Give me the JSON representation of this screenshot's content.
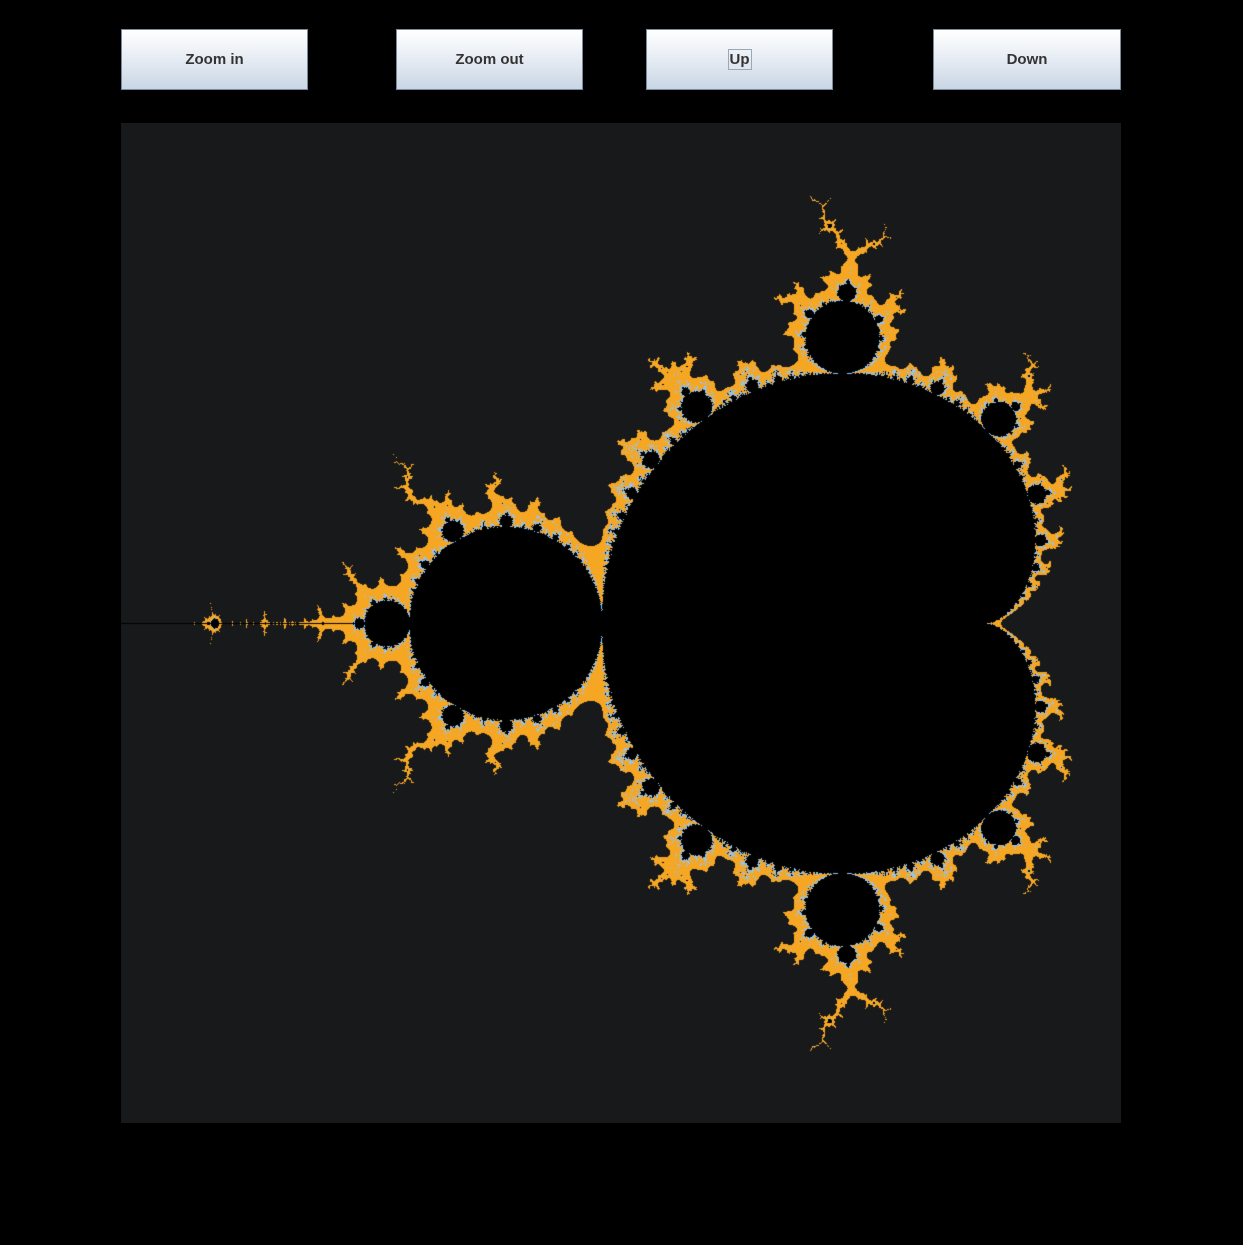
{
  "toolbar": {
    "zoom_in_label": "Zoom in",
    "zoom_out_label": "Zoom out",
    "up_label": "Up",
    "down_label": "Down"
  },
  "fractal": {
    "type": "mandelbrot",
    "view": {
      "x_min": -2.0,
      "x_max": 0.6,
      "y_min": -1.3,
      "y_max": 1.3
    },
    "max_iterations": 200,
    "colors": {
      "background": "#18191b",
      "set_interior": "#000000",
      "boundary": "#f5a623",
      "highlight": "#8fc6ff"
    }
  }
}
